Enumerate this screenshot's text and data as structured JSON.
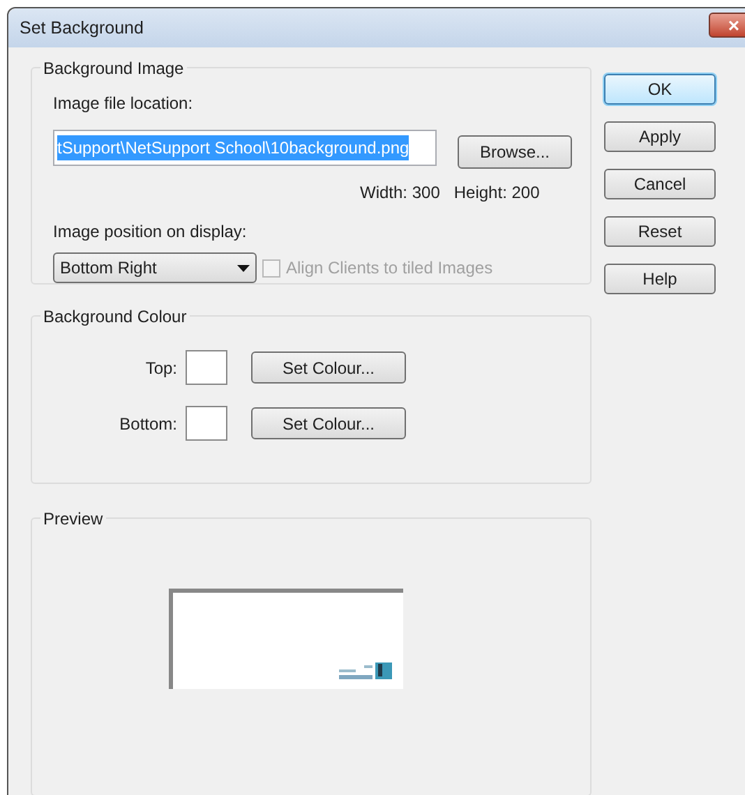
{
  "window": {
    "title": "Set Background",
    "close": "×"
  },
  "background_image": {
    "title": "Background Image",
    "location_label": "Image file location:",
    "location_value": "tSupport\\NetSupport School\\10background.png",
    "browse": "Browse...",
    "width_text": "Width: 300",
    "height_text": "Height: 200",
    "position_label": "Image position on display:",
    "position_value": "Bottom Right",
    "align": {
      "label": "Align Clients to tiled Images",
      "checked": false,
      "disabled": true
    }
  },
  "background_colour": {
    "title": "Background Colour",
    "rows": [
      {
        "label": "Top:",
        "button": "Set Colour..."
      },
      {
        "label": "Bottom:",
        "button": "Set Colour..."
      }
    ]
  },
  "preview": {
    "title": "Preview"
  },
  "buttons": [
    {
      "label": "OK",
      "default": true
    },
    {
      "label": "Apply",
      "default": false
    },
    {
      "label": "Cancel",
      "default": false
    },
    {
      "label": "Reset",
      "default": false
    },
    {
      "label": "Help",
      "default": false
    }
  ]
}
